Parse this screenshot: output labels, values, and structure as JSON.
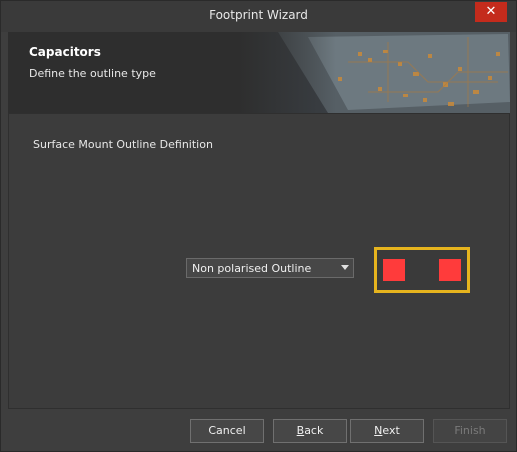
{
  "window": {
    "title": "Footprint Wizard",
    "close_glyph": "✕"
  },
  "header": {
    "title": "Capacitors",
    "subtitle": "Define the outline type"
  },
  "content": {
    "section_label": "Surface Mount Outline Definition",
    "outline_select": {
      "value": "Non polarised Outline"
    },
    "preview": {
      "border_color": "#e6b41e",
      "pad_color": "#ff3b3b"
    }
  },
  "footer": {
    "cancel": {
      "label": "Cancel"
    },
    "back": {
      "mnemonic": "B",
      "rest": "ack"
    },
    "next": {
      "mnemonic": "N",
      "rest": "ext"
    },
    "finish": {
      "label": "Finish"
    }
  }
}
